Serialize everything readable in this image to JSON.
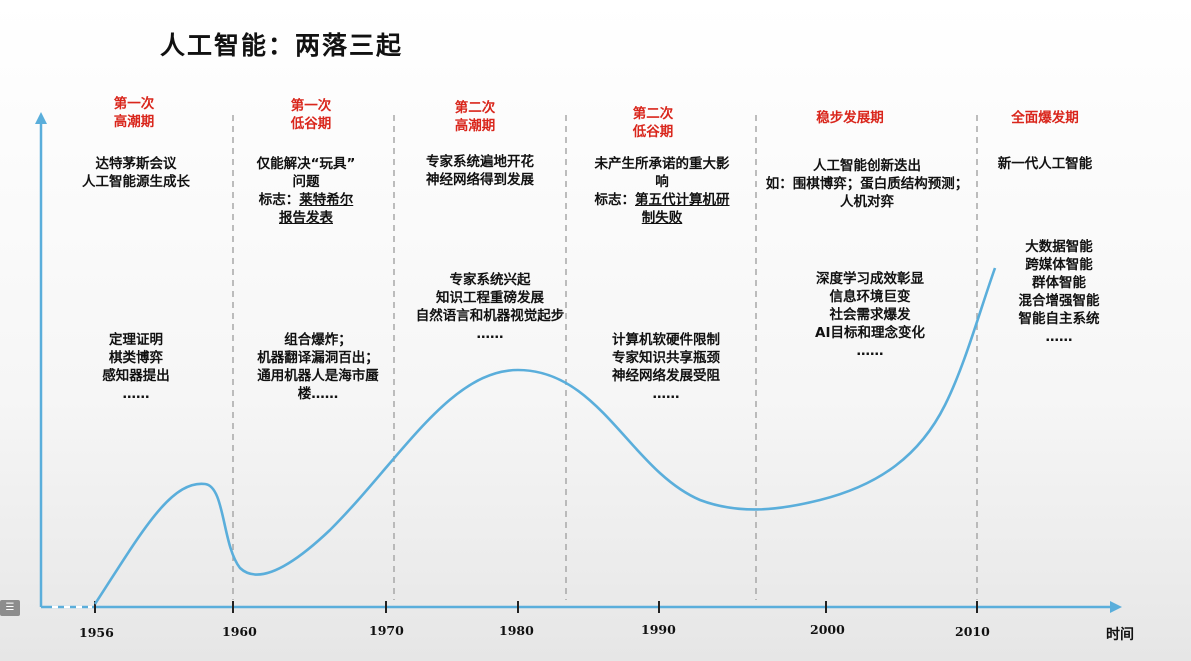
{
  "title": "人工智能：两落三起",
  "axis_label": "时间",
  "years": [
    "1956",
    "1960",
    "1970",
    "1980",
    "1990",
    "2000",
    "2010"
  ],
  "periods": [
    {
      "name_line1": "第一次",
      "name_line2": "高潮期",
      "top": [
        "达特茅斯会议",
        "人工智能源生成长"
      ],
      "mid": [
        "定理证明",
        "棋类博弈",
        "感知器提出",
        "……"
      ]
    },
    {
      "name_line1": "第一次",
      "name_line2": "低谷期",
      "top": [
        "仅能解决“玩具”",
        "问题",
        "标志：",
        "莱特希尔",
        "报告发表"
      ],
      "mid": [
        "组合爆炸；",
        "机器翻译漏洞百出；",
        "通用机器人是海市蜃",
        "楼……"
      ]
    },
    {
      "name_line1": "第二次",
      "name_line2": "高潮期",
      "top": [
        "专家系统遍地开花",
        "神经网络得到发展"
      ],
      "mid": [
        "专家系统兴起",
        "知识工程重磅发展",
        "自然语言和机器视觉起步",
        "……"
      ]
    },
    {
      "name_line1": "第二次",
      "name_line2": "低谷期",
      "top": [
        "未产生所承诺的重大影",
        "响",
        "标志：",
        "第五代计算机研",
        "制失败"
      ],
      "mid": [
        "计算机软硬件限制",
        "专家知识共享瓶颈",
        "神经网络发展受阻",
        "……"
      ]
    },
    {
      "name_line1": "稳步发展期",
      "name_line2": "",
      "top": [
        "人工智能创新迭出",
        "如：围棋博弈；蛋白质结构预测；",
        "人机对弈"
      ],
      "mid": [
        "深度学习成效彰显",
        "信息环境巨变",
        "社会需求爆发",
        "AI目标和理念变化",
        "……"
      ]
    },
    {
      "name_line1": "全面爆发期",
      "name_line2": "",
      "top": [
        "新一代人工智能"
      ],
      "mid": [
        "大数据智能",
        "跨媒体智能",
        "群体智能",
        "混合增强智能",
        "智能自主系统",
        "……"
      ]
    }
  ],
  "colors": {
    "curve": "#5aaedb",
    "axis": "#5aaedb",
    "period": "#d9261c",
    "divider": "#a8a8a8"
  },
  "icons": {
    "menu": "list-icon"
  }
}
